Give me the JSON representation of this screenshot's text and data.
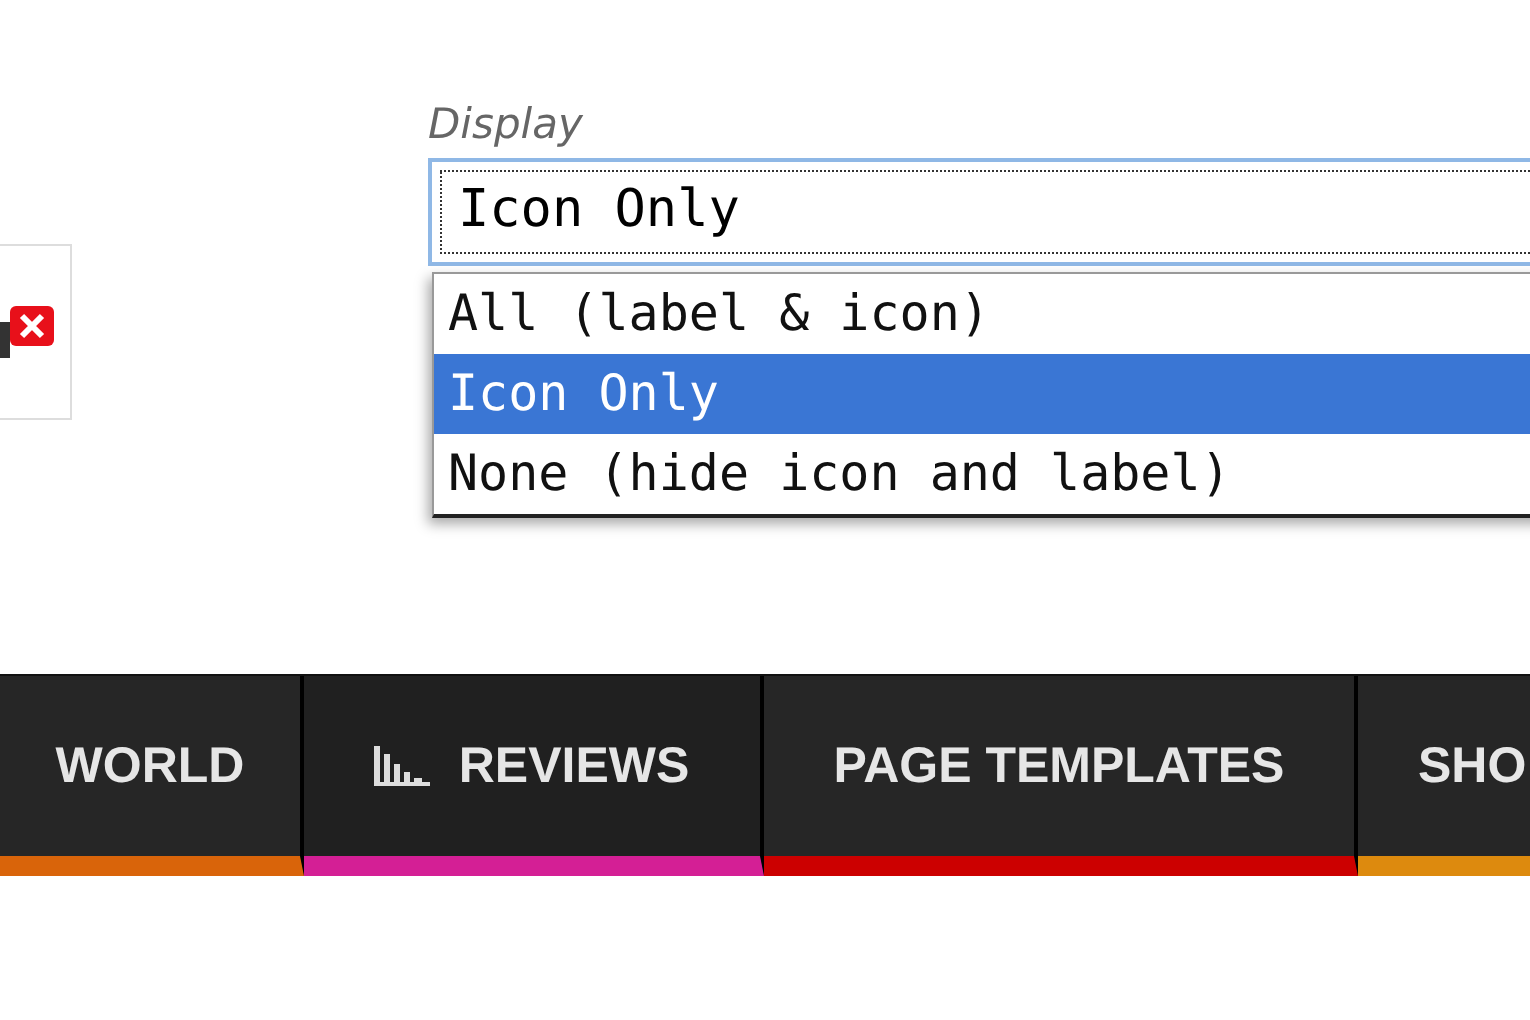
{
  "display_field": {
    "label": "Display",
    "value": "Icon Only",
    "options": [
      {
        "label": "All (label & icon)",
        "selected": false
      },
      {
        "label": "Icon Only",
        "selected": true
      },
      {
        "label": "None (hide icon and label)",
        "selected": false
      }
    ]
  },
  "nav": {
    "items": [
      {
        "label": "WORLD",
        "color": "#d9640a",
        "kind": "text"
      },
      {
        "label": "REVIEWS",
        "color": "#d41f95",
        "kind": "icon"
      },
      {
        "label": "PAGE TEMPLATES",
        "color": "#cc0000",
        "kind": "text"
      },
      {
        "label": "SHO",
        "color": "#dd8a0e",
        "kind": "text"
      }
    ]
  }
}
